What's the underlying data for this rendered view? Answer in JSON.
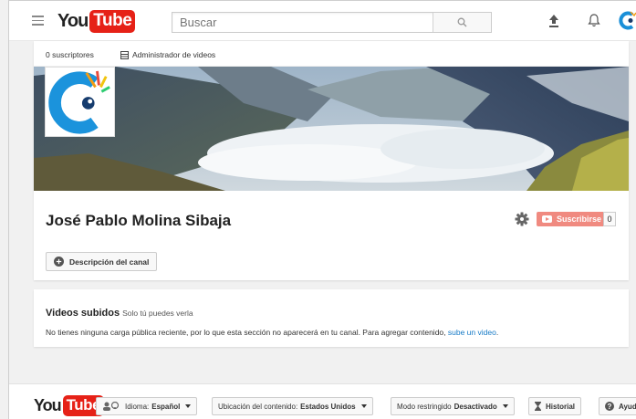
{
  "masthead": {
    "logo_you": "You",
    "logo_tube": "Tube",
    "search_placeholder": "Buscar",
    "icons": [
      "menu-icon",
      "search-icon",
      "upload-icon",
      "bell-icon",
      "avatar"
    ]
  },
  "channel": {
    "subscribers": "0 suscriptores",
    "video_manager": "Administrador de videos",
    "name": "José Pablo Molina Sibaja",
    "subscribe_label": "Suscribirse",
    "subscribe_count": "0",
    "description_button": "Descripción del canal"
  },
  "uploads": {
    "title": "Videos subidos",
    "visibility": "Solo tú puedes verla",
    "message": "No tienes ninguna carga pública reciente, por lo que esta sección no aparecerá en tu canal. Para agregar contenido, ",
    "link": "sube un video",
    "end": "."
  },
  "footer": {
    "logo_you": "You",
    "logo_tube": "Tube",
    "language_label": "Idioma:",
    "language_value": "Español",
    "location_label": "Ubicación del contenido:",
    "location_value": "Estados Unidos",
    "restricted_label": "Modo restringido",
    "restricted_value": "Desactivado",
    "history": "Historial",
    "help": "Ayuda"
  },
  "colors": {
    "brand_red": "#e62117",
    "subscribe_disabled": "#f08a80",
    "link_blue": "#167ac6"
  }
}
